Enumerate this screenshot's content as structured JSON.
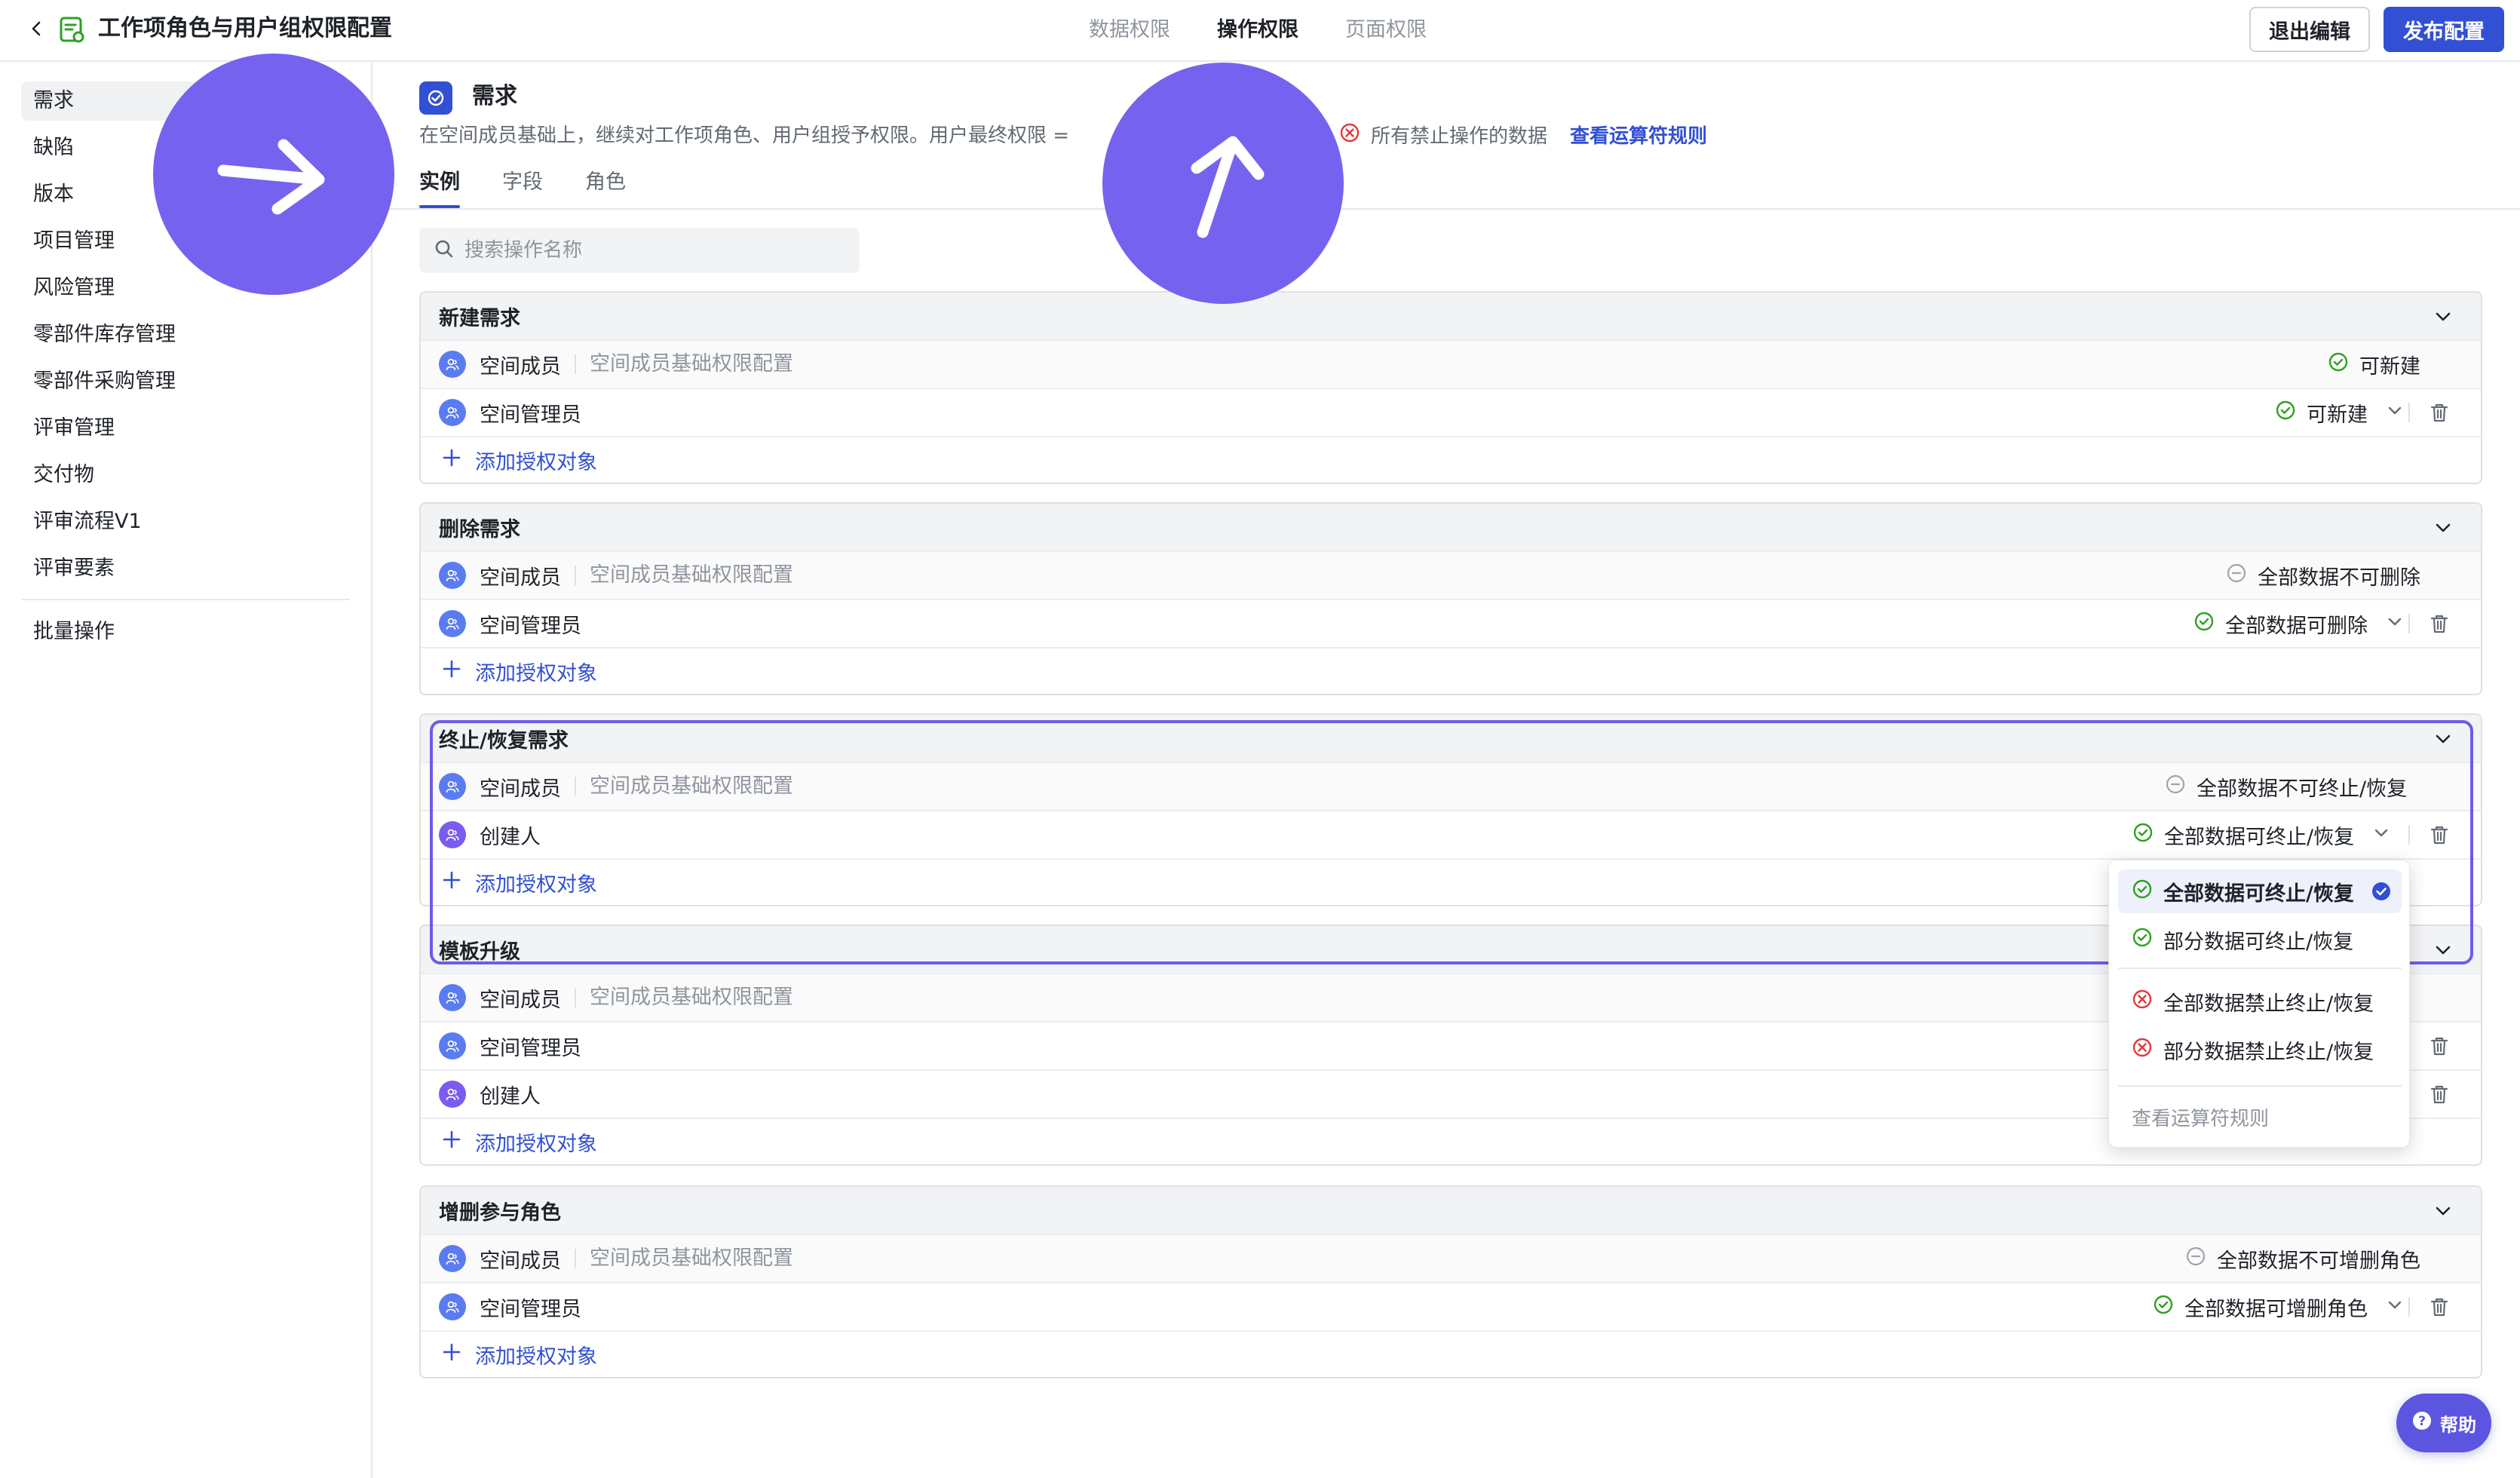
{
  "header": {
    "title": "工作项角色与用户组权限配置",
    "tabs": [
      "数据权限",
      "操作权限",
      "页面权限"
    ],
    "active_tab": "操作权限",
    "exit_label": "退出编辑",
    "publish_label": "发布配置"
  },
  "sidebar": {
    "items": [
      "需求",
      "缺陷",
      "版本",
      "项目管理",
      "风险管理",
      "零部件库存管理",
      "零部件采购管理",
      "评审管理",
      "交付物",
      "评审流程V1",
      "评审要素"
    ],
    "active": "需求",
    "batch": "批量操作"
  },
  "section": {
    "title": "需求",
    "desc_a": "在空间成员基础上，继续对工作项角色、用户组授予权限。用户最终权限 =",
    "desc_b": "所有禁止操作的数据",
    "link": "查看运算符规则",
    "tabs": [
      "实例",
      "字段",
      "角色"
    ],
    "active_tab": "实例"
  },
  "search": {
    "placeholder": "搜索操作名称"
  },
  "common": {
    "base_sub": "空间成员基础权限配置",
    "add_label": "添加授权对象"
  },
  "cards": [
    {
      "title": "新建需求",
      "rows": [
        {
          "name": "空间成员",
          "sub": true,
          "perm": "可新建",
          "state": "ok",
          "editable": false
        },
        {
          "name": "空间管理员",
          "sub": false,
          "perm": "可新建",
          "state": "ok",
          "editable": true
        }
      ]
    },
    {
      "title": "删除需求",
      "rows": [
        {
          "name": "空间成员",
          "sub": true,
          "perm": "全部数据不可删除",
          "state": "none",
          "editable": false
        },
        {
          "name": "空间管理员",
          "sub": false,
          "perm": "全部数据可删除",
          "state": "ok",
          "editable": true
        }
      ]
    },
    {
      "title": "终止/恢复需求",
      "rows": [
        {
          "name": "空间成员",
          "sub": true,
          "perm": "全部数据不可终止/恢复",
          "state": "none",
          "editable": false
        },
        {
          "name": "创建人",
          "sub": false,
          "perm": "全部数据可终止/恢复",
          "state": "ok",
          "editable": true
        }
      ]
    },
    {
      "title": "模板升级",
      "rows": [
        {
          "name": "空间成员",
          "sub": true,
          "perm": "",
          "state": "",
          "editable": false
        },
        {
          "name": "空间管理员",
          "sub": false,
          "perm": "",
          "state": "",
          "editable": true
        },
        {
          "name": "创建人",
          "sub": false,
          "perm": "",
          "state": "",
          "editable": true
        }
      ]
    },
    {
      "title": "增删参与角色",
      "rows": [
        {
          "name": "空间成员",
          "sub": true,
          "perm": "全部数据不可增删角色",
          "state": "none",
          "editable": false
        },
        {
          "name": "空间管理员",
          "sub": false,
          "perm": "全部数据可增删角色",
          "state": "ok",
          "editable": true
        }
      ]
    }
  ],
  "dropdown": {
    "options": [
      {
        "label": "全部数据可终止/恢复",
        "state": "ok",
        "selected": true
      },
      {
        "label": "部分数据可终止/恢复",
        "state": "ok",
        "selected": false
      },
      {
        "label": "全部数据禁止终止/恢复",
        "state": "deny",
        "selected": false
      },
      {
        "label": "部分数据禁止终止/恢复",
        "state": "deny",
        "selected": false
      }
    ],
    "rule_link": "查看运算符规则"
  },
  "help": {
    "label": "帮助"
  },
  "colors": {
    "accent": "#3250d3",
    "ok": "#2ea121",
    "deny": "#e4373c",
    "overlay": "#7563ef"
  }
}
